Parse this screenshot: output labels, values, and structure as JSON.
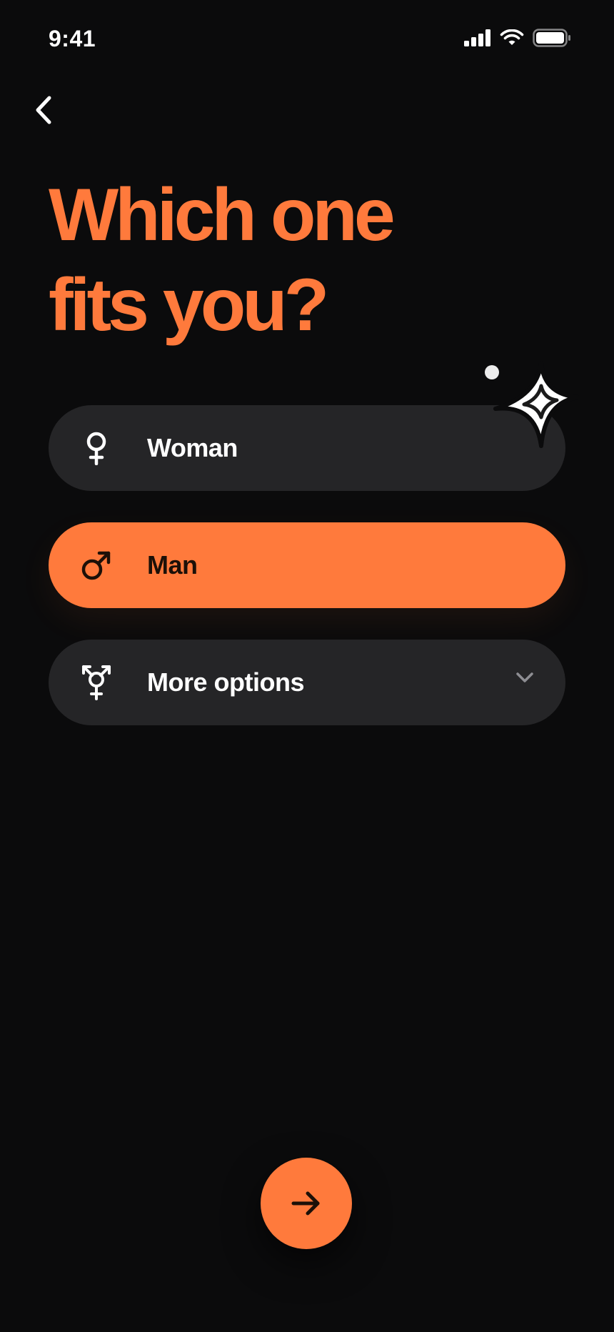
{
  "status_bar": {
    "time": "9:41",
    "icons": [
      "signal-icon",
      "wifi-icon",
      "battery-icon"
    ]
  },
  "navigation": {
    "back_icon": "chevron-left-icon"
  },
  "title": {
    "line1": "Which one",
    "line2": "fits you?"
  },
  "options": [
    {
      "label": "Woman",
      "icon": "female-symbol-icon",
      "selected": false
    },
    {
      "label": "Man",
      "icon": "male-symbol-icon",
      "selected": true
    },
    {
      "label": "More options",
      "icon": "transgender-symbol-icon",
      "selected": false,
      "expandable": true
    }
  ],
  "next_button": {
    "icon": "arrow-right-icon"
  },
  "colors": {
    "background": "#0b0b0c",
    "accent": "#ff7a3c",
    "option_background": "#252527",
    "text": "#ffffff"
  }
}
